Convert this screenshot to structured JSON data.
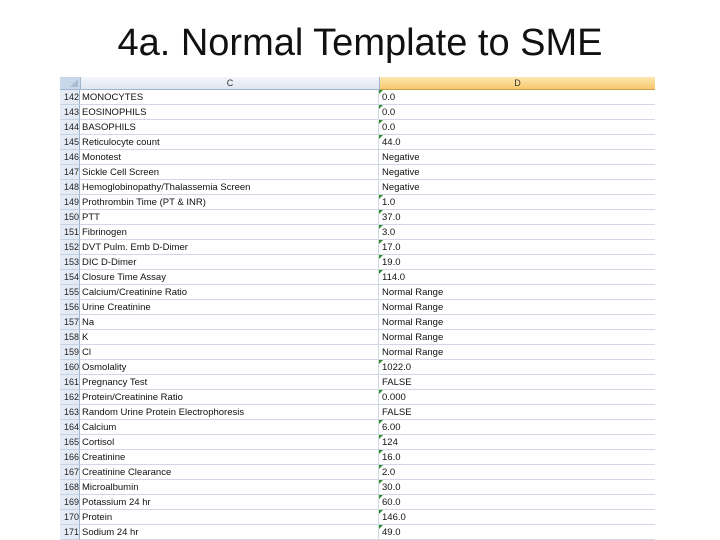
{
  "title": "4a. Normal Template to SME",
  "columns": {
    "c": "C",
    "d": "D"
  },
  "colors": {
    "indicator": "#2e8b2e",
    "selected_header": "#f8c76c"
  },
  "rows": [
    {
      "n": "142",
      "c": "MONOCYTES",
      "d": "0.0",
      "flag": true
    },
    {
      "n": "143",
      "c": "EOSINOPHILS",
      "d": "0.0",
      "flag": true
    },
    {
      "n": "144",
      "c": "BASOPHILS",
      "d": "0.0",
      "flag": true
    },
    {
      "n": "145",
      "c": "Reticulocyte count",
      "d": "44.0",
      "flag": true
    },
    {
      "n": "146",
      "c": "Monotest",
      "d": "Negative",
      "flag": false
    },
    {
      "n": "147",
      "c": "Sickle Cell Screen",
      "d": "Negative",
      "flag": false
    },
    {
      "n": "148",
      "c": "Hemoglobinopathy/Thalassemia Screen",
      "d": "Negative",
      "flag": false
    },
    {
      "n": "149",
      "c": "Prothrombin Time (PT & INR)",
      "d": "1.0",
      "flag": true
    },
    {
      "n": "150",
      "c": "PTT",
      "d": "37.0",
      "flag": true
    },
    {
      "n": "151",
      "c": "Fibrinogen",
      "d": "3.0",
      "flag": true
    },
    {
      "n": "152",
      "c": "DVT Pulm. Emb D-Dimer",
      "d": "17.0",
      "flag": true
    },
    {
      "n": "153",
      "c": "DIC D-Dimer",
      "d": "19.0",
      "flag": true
    },
    {
      "n": "154",
      "c": "Closure Time Assay",
      "d": "114.0",
      "flag": true
    },
    {
      "n": "155",
      "c": "Calcium/Creatinine Ratio",
      "d": "Normal Range",
      "flag": false
    },
    {
      "n": "156",
      "c": "Urine Creatinine",
      "d": "Normal Range",
      "flag": false
    },
    {
      "n": "157",
      "c": "Na",
      "d": "Normal Range",
      "flag": false
    },
    {
      "n": "158",
      "c": "K",
      "d": "Normal Range",
      "flag": false
    },
    {
      "n": "159",
      "c": "Cl",
      "d": "Normal Range",
      "flag": false
    },
    {
      "n": "160",
      "c": "Osmolality",
      "d": "1022.0",
      "flag": true
    },
    {
      "n": "161",
      "c": "Pregnancy Test",
      "d": "FALSE",
      "flag": false
    },
    {
      "n": "162",
      "c": "Protein/Creatinine Ratio",
      "d": "0.000",
      "flag": true
    },
    {
      "n": "163",
      "c": "Random Urine Protein Electrophoresis",
      "d": "FALSE",
      "flag": false
    },
    {
      "n": "164",
      "c": "Calcium",
      "d": "6.00",
      "flag": true
    },
    {
      "n": "165",
      "c": "Cortisol",
      "d": "124",
      "flag": true
    },
    {
      "n": "166",
      "c": "Creatinine",
      "d": "16.0",
      "flag": true
    },
    {
      "n": "167",
      "c": "Creatinine Clearance",
      "d": "2.0",
      "flag": true
    },
    {
      "n": "168",
      "c": "Microalbumin",
      "d": "30.0",
      "flag": true
    },
    {
      "n": "169",
      "c": "Potassium 24 hr",
      "d": "60.0",
      "flag": true
    },
    {
      "n": "170",
      "c": "Protein",
      "d": "146.0",
      "flag": true
    },
    {
      "n": "171",
      "c": "Sodium 24 hr",
      "d": "49.0",
      "flag": true
    }
  ]
}
